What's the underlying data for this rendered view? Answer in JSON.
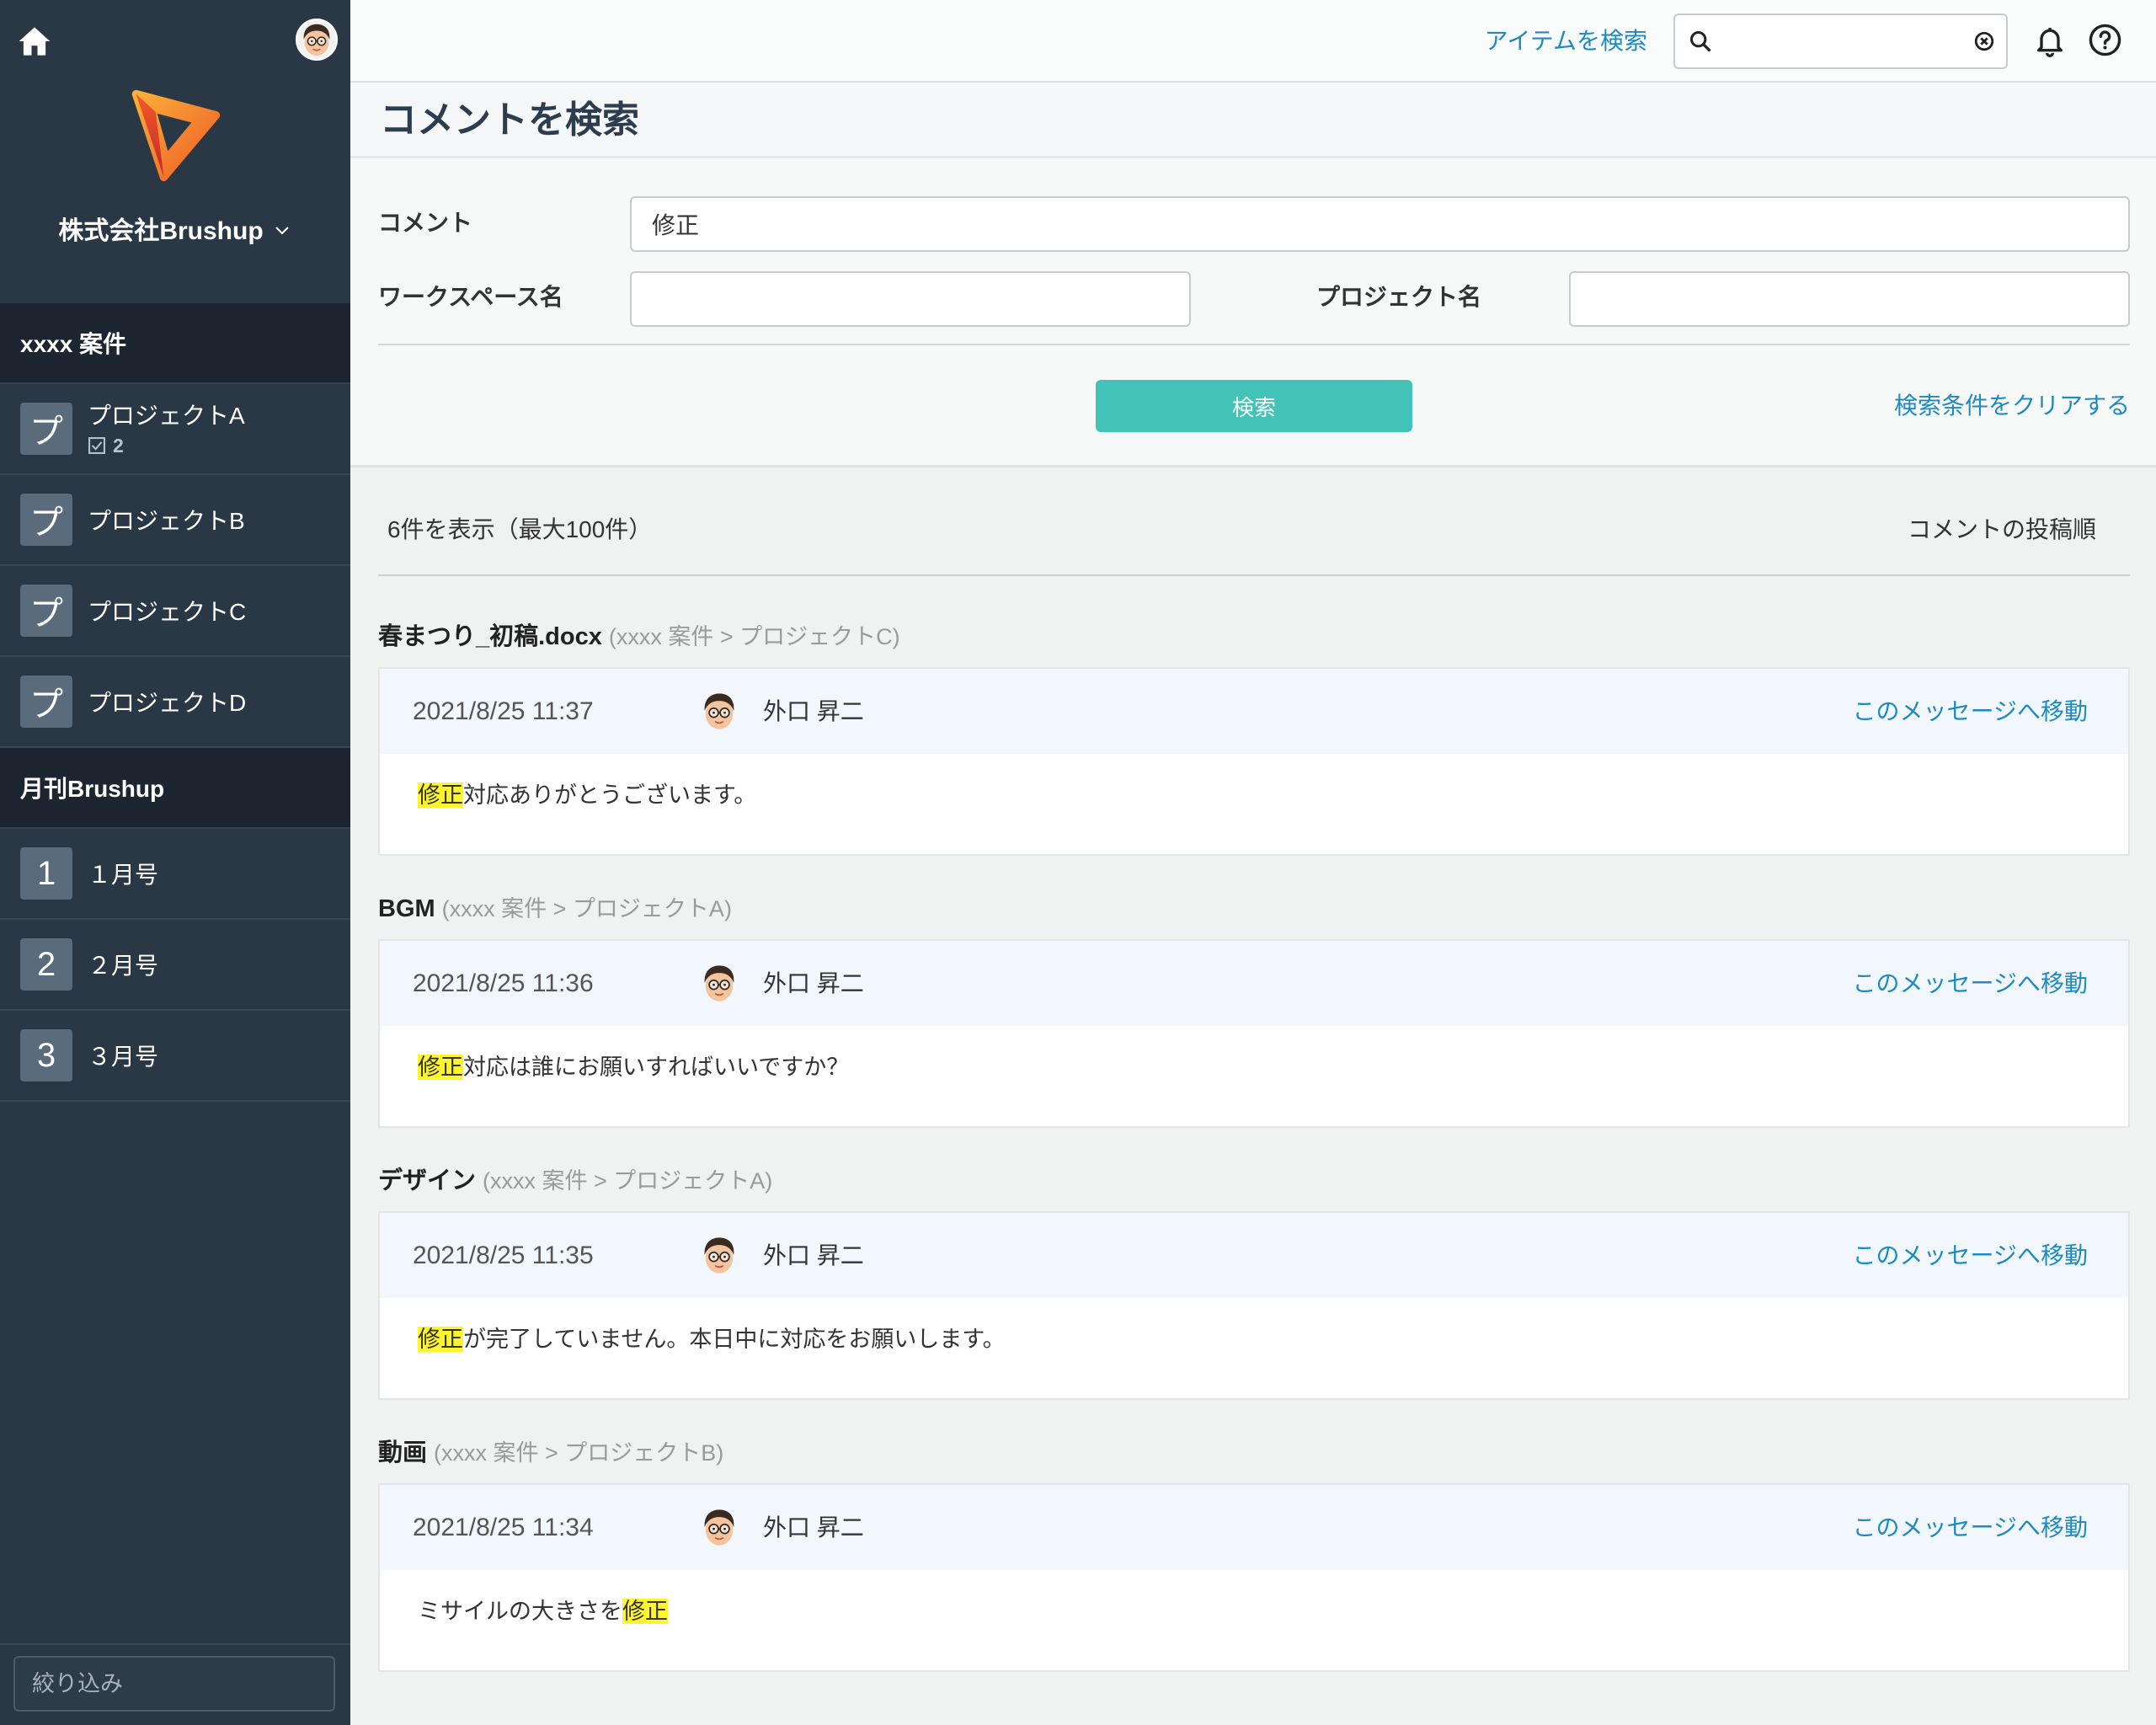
{
  "topbar": {
    "item_search_link": "アイテムを検索",
    "search_value": ""
  },
  "sidebar": {
    "company_name": "株式会社Brushup",
    "groups": [
      {
        "name": "xxxx 案件",
        "items": [
          {
            "icon_text": "プ",
            "label": "プロジェクトA",
            "task_count": "2"
          },
          {
            "icon_text": "プ",
            "label": "プロジェクトB"
          },
          {
            "icon_text": "プ",
            "label": "プロジェクトC"
          },
          {
            "icon_text": "プ",
            "label": "プロジェクトD"
          }
        ]
      },
      {
        "name": "月刊Brushup",
        "items": [
          {
            "icon_text": "1",
            "label": "１月号"
          },
          {
            "icon_text": "2",
            "label": "２月号"
          },
          {
            "icon_text": "3",
            "label": "３月号"
          }
        ]
      }
    ],
    "filter_placeholder": "絞り込み"
  },
  "page": {
    "title": "コメントを検索"
  },
  "search_form": {
    "comment_label": "コメント",
    "comment_value": "修正",
    "workspace_label": "ワークスペース名",
    "workspace_value": "",
    "project_label": "プロジェクト名",
    "project_value": "",
    "search_button": "検索",
    "clear_link": "検索条件をクリアする"
  },
  "results": {
    "summary": "6件を表示（最大100件）",
    "sort_label": "コメントの投稿順",
    "items": [
      {
        "item_name": "春まつり_初稿.docx",
        "path": "(xxxx 案件 > プロジェクトC)",
        "posted_at": "2021/8/25 11:37",
        "author": "外口 昇二",
        "jump_link": "このメッセージへ移動",
        "segments": [
          {
            "text": "修正",
            "highlight": true
          },
          {
            "text": "対応ありがとうございます。",
            "highlight": false
          }
        ]
      },
      {
        "item_name": "BGM",
        "path": "(xxxx 案件 > プロジェクトA)",
        "posted_at": "2021/8/25 11:36",
        "author": "外口 昇二",
        "jump_link": "このメッセージへ移動",
        "segments": [
          {
            "text": "修正",
            "highlight": true
          },
          {
            "text": "対応は誰にお願いすればいいですか？",
            "highlight": false
          }
        ]
      },
      {
        "item_name": "デザイン",
        "path": "(xxxx 案件 > プロジェクトA)",
        "posted_at": "2021/8/25 11:35",
        "author": "外口 昇二",
        "jump_link": "このメッセージへ移動",
        "segments": [
          {
            "text": "修正",
            "highlight": true
          },
          {
            "text": "が完了していません。本日中に対応をお願いします。",
            "highlight": false
          }
        ]
      },
      {
        "item_name": "動画",
        "path": "(xxxx 案件 > プロジェクトB)",
        "posted_at": "2021/8/25 11:34",
        "author": "外口 昇二",
        "jump_link": "このメッセージへ移動",
        "segments": [
          {
            "text": "ミサイルの大きさを",
            "highlight": false
          },
          {
            "text": "修正",
            "highlight": true
          }
        ]
      }
    ]
  },
  "icons": {
    "home": "home-icon",
    "avatar": "user-avatar",
    "logo": "brushup-logo",
    "company_menu": "chevron-down-icon",
    "task": "task-check-icon",
    "search": "search-icon",
    "clear": "clear-icon",
    "notifications": "bell-icon",
    "help": "help-icon"
  },
  "colors": {
    "sidebar": "#2a3846",
    "sidebar_group_header": "#1c2530",
    "accent": "#43c3b7",
    "link": "#1e8ac2",
    "highlight": "#fff52e",
    "card_header": "#f1f7fc"
  }
}
